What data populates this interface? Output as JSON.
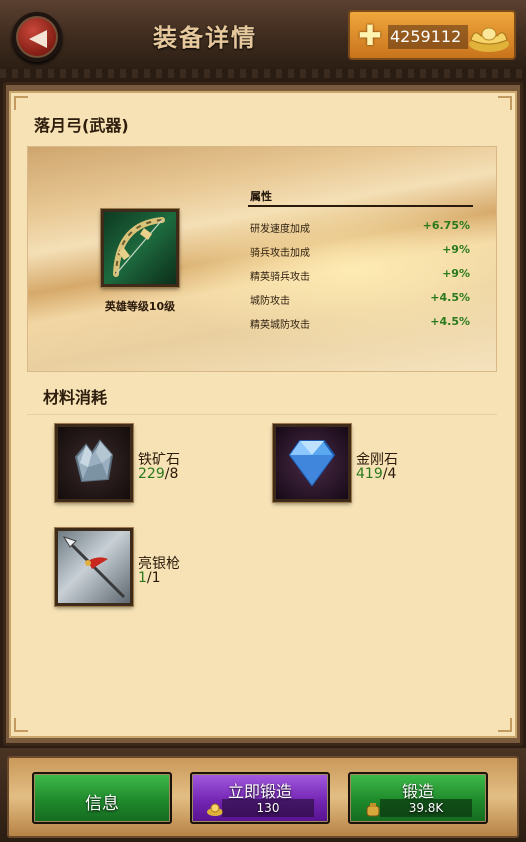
{
  "header": {
    "title": "装备详情",
    "currency_amount": "4259112",
    "icons": {
      "back": "back-arrow-icon",
      "add": "plus-icon",
      "ingot": "gold-ingot-icon"
    }
  },
  "item": {
    "title": "落月弓(武器)",
    "icon": "bow-icon",
    "caption": "英雄等级10级",
    "attributes_header": "属性",
    "attributes": [
      {
        "name": "研发速度加成",
        "value": "+6.75%"
      },
      {
        "name": "骑兵攻击加成",
        "value": "+9%"
      },
      {
        "name": "精英骑兵攻击",
        "value": "+9%"
      },
      {
        "name": "城防攻击",
        "value": "+4.5%"
      },
      {
        "name": "精英城防攻击",
        "value": "+4.5%"
      }
    ]
  },
  "materials": {
    "title": "材料消耗",
    "items": [
      {
        "name": "铁矿石",
        "have": "229",
        "need": "8",
        "icon": "iron-ore-icon"
      },
      {
        "name": "金刚石",
        "have": "419",
        "need": "4",
        "icon": "diamond-icon"
      },
      {
        "name": "亮银枪",
        "have": "1",
        "need": "1",
        "icon": "spear-icon"
      }
    ]
  },
  "footer": {
    "info_label": "信息",
    "instant_label": "立即锻造",
    "instant_cost": "130",
    "forge_label": "锻造",
    "forge_cost": "39.8K"
  },
  "colors": {
    "positive": "#2a7a1d",
    "green_button": "#1f8a2b",
    "purple_button": "#7326b3",
    "panel": "#f6e2b5"
  }
}
